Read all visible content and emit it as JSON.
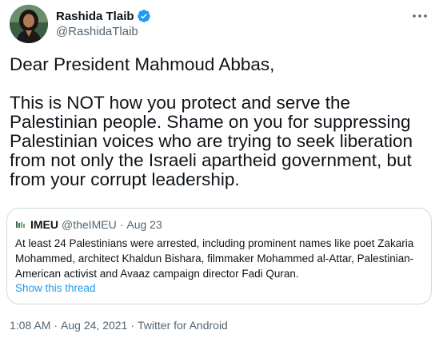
{
  "author": {
    "display_name": "Rashida Tlaib",
    "handle": "@RashidaTlaib"
  },
  "tweet": {
    "text": "Dear President Mahmoud Abbas,\n\nThis is NOT how you protect and serve the Palestinian people. Shame on you for suppressing Palestinian voices who are trying to seek liberation from not only the Israeli apartheid government, but from your corrupt leadership."
  },
  "quote": {
    "name": "IMEU",
    "handle": "@theIMEU",
    "separator": "·",
    "date": "Aug 23",
    "text": "At least 24 Palestinians were arrested, including prominent names like poet Zakaria Mohammed, architect Khaldun Bishara, filmmaker Mohammed al-Attar, Palestinian-American activist and Avaaz campaign director Fadi Quran.",
    "show_thread": "Show this thread"
  },
  "meta": {
    "time": "1:08 AM",
    "date": "Aug 24, 2021",
    "separator": "·",
    "source": "Twitter for Android"
  },
  "icons": {
    "verified": "verified-badge-icon",
    "more": "more-options-icon",
    "quote_logo": "imeu-logo-icon"
  },
  "colors": {
    "text": "#0f1419",
    "secondary": "#536471",
    "accent": "#1d9bf0",
    "border": "#cfd9de"
  }
}
